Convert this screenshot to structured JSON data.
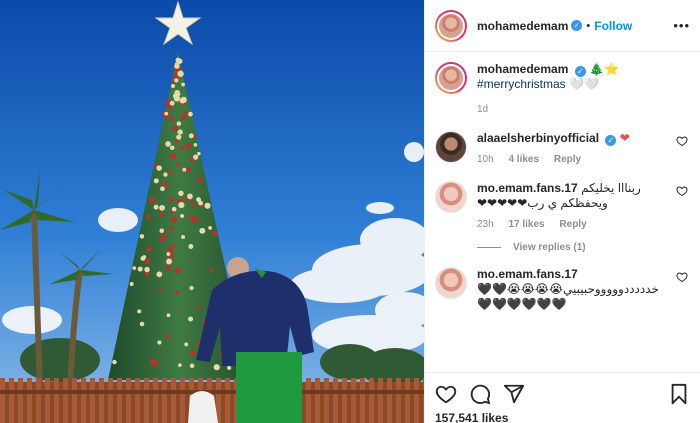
{
  "post": {
    "username": "mohamedemam",
    "follow_label": "Follow",
    "more_label": "•••",
    "likes_count": "157,541 likes"
  },
  "caption": {
    "username": "mohamedemam",
    "emojis": "🎄⭐",
    "hashtag": "#merrychristmas",
    "suffix": "🤍🤍",
    "time": "1d"
  },
  "comments": [
    {
      "username": "alaaelsherbinyofficial",
      "text": "❤",
      "time": "10h",
      "likes": "4 likes",
      "reply": "Reply"
    },
    {
      "username": "mo.emam.fans.17",
      "text": "ربنااا يخليكم ويحفظكم ي رب❤❤❤❤❤",
      "time": "23h",
      "likes": "17 likes",
      "reply": "Reply",
      "view_replies": "View replies (1)"
    },
    {
      "username": "mo.emam.fans.17",
      "text": "خدددددوووووحبيبيي😭😭😭😭🖤🖤 🖤🖤🖤🖤🖤🖤"
    }
  ],
  "colors": {
    "accent": "#0095f6",
    "verified": "#3897f0",
    "heart": "#ed4956",
    "muted": "#8e8e8e"
  },
  "icons": [
    "verified-badge-icon",
    "heart-icon",
    "comment-icon",
    "share-icon",
    "bookmark-icon",
    "more-options-icon"
  ]
}
